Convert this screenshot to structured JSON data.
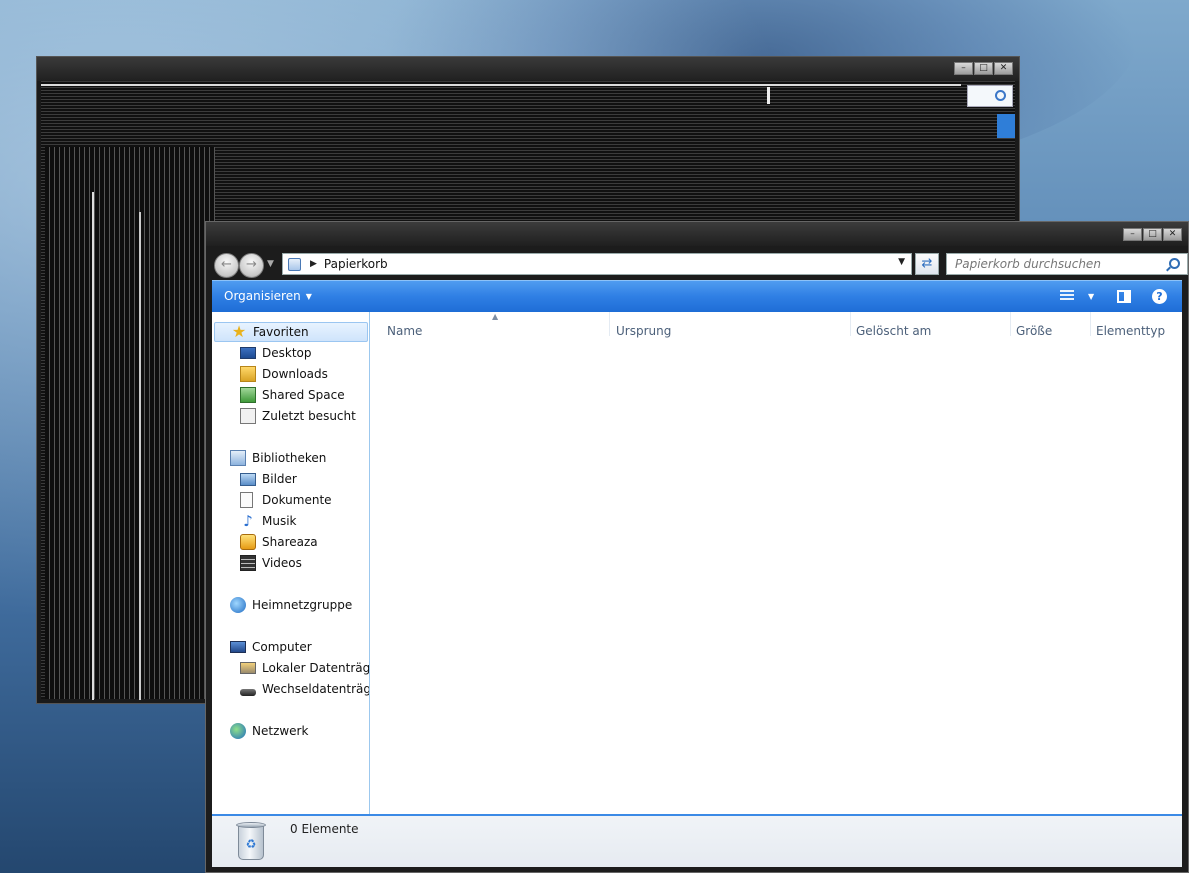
{
  "explorer": {
    "breadcrumb": [
      "Papierkorb"
    ],
    "search_placeholder": "Papierkorb durchsuchen",
    "toolbar": {
      "organize_label": "Organisieren"
    },
    "nav": {
      "favorites": {
        "label": "Favoriten",
        "items": [
          "Desktop",
          "Downloads",
          "Shared Space",
          "Zuletzt besucht"
        ]
      },
      "libraries": {
        "label": "Bibliotheken",
        "items": [
          "Bilder",
          "Dokumente",
          "Musik",
          "Shareaza",
          "Videos"
        ]
      },
      "homegroup": {
        "label": "Heimnetzgruppe"
      },
      "computer": {
        "label": "Computer",
        "items": [
          "Lokaler Datenträger",
          "Wechseldatenträge"
        ]
      },
      "network": {
        "label": "Netzwerk"
      }
    },
    "columns": [
      "Name",
      "Ursprung",
      "Gelöscht am",
      "Größe",
      "Elementtyp"
    ],
    "status": {
      "count_text": "0 Elemente"
    }
  },
  "icons": {
    "nav_back": "arrow-left-icon",
    "nav_forward": "arrow-right-icon",
    "search": "search-icon",
    "refresh": "refresh-icon",
    "help": "help-icon",
    "recycle_bin": "recycle-bin-icon"
  },
  "colors": {
    "toolbar_blue": "#2f7fe4",
    "selection": "#cfe4fb",
    "status_border": "#3b8ae6"
  }
}
